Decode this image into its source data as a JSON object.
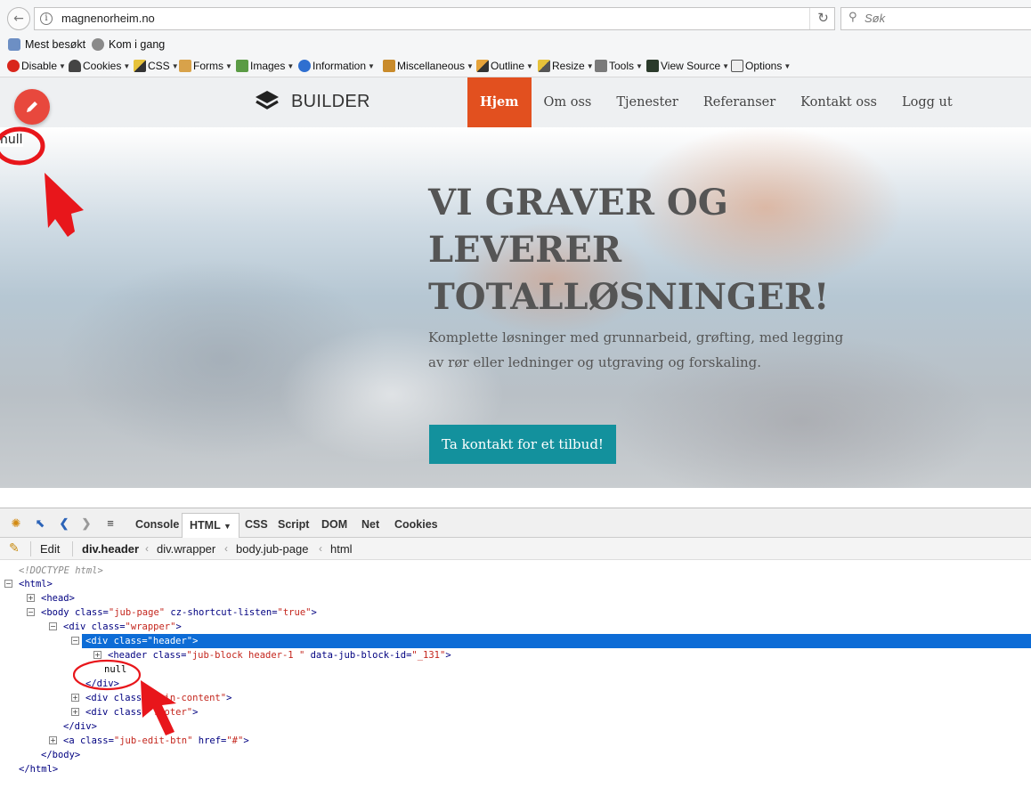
{
  "browser": {
    "url": "magnenorheim.no",
    "search_placeholder": "Søk",
    "bookmarks": [
      "Mest besøkt",
      "Kom i gang"
    ],
    "dev_toolbar": [
      "Disable",
      "Cookies",
      "CSS",
      "Forms",
      "Images",
      "Information",
      "Miscellaneous",
      "Outline",
      "Resize",
      "Tools",
      "View Source",
      "Options"
    ]
  },
  "site": {
    "brand": "BUILDER",
    "nav": [
      "Hjem",
      "Om oss",
      "Tjenester",
      "Referanser",
      "Kontakt oss",
      "Logg ut"
    ],
    "active_nav": "Hjem",
    "null_text": "null",
    "hero": {
      "title": "VI GRAVER OG LEVERER TOTALLØSNINGER!",
      "subtitle": "Komplette løsninger med grunnarbeid, grøfting, med legging av rør eller ledninger og utgraving og forskaling.",
      "cta": "Ta kontakt for et tilbud!"
    }
  },
  "firebug": {
    "tabs": [
      "Console",
      "HTML",
      "CSS",
      "Script",
      "DOM",
      "Net",
      "Cookies"
    ],
    "active_tab": "HTML",
    "edit_label": "Edit",
    "breadcrumbs": [
      "div.header",
      "div.wrapper",
      "body.jub-page",
      "html"
    ],
    "tree": {
      "doctype": "<!DOCTYPE html>",
      "html_open": "<html>",
      "head": "<head>",
      "body_open": [
        "<body ",
        "class=",
        "\"jub-page\"",
        " cz-shortcut-listen=",
        "\"true\"",
        ">"
      ],
      "wrapper_open": [
        "<div ",
        "class=",
        "\"wrapper\"",
        ">"
      ],
      "header_open": [
        "<div ",
        "class=",
        "\"header\"",
        ">"
      ],
      "header_el": [
        "<header ",
        "class=",
        "\"jub-block header-1 \"",
        " data-jub-block-id=",
        "\"_131\"",
        ">"
      ],
      "null_node": "null",
      "div_close": "</div>",
      "main_content": [
        "<div ",
        "class=",
        "\"main-content\"",
        ">"
      ],
      "footer": [
        "<div ",
        "class=",
        "\"footer\"",
        ">"
      ],
      "wrapper_close": "</div>",
      "edit_btn": [
        "<a ",
        "class=",
        "\"jub-edit-btn\"",
        " href=",
        "\"#\"",
        ">"
      ],
      "body_close": "</body>",
      "html_close": "</html>"
    }
  },
  "colors": {
    "accent_nav": "#e2501f",
    "cta": "#13919d",
    "edit_fab": "#e8483d",
    "selection": "#0d6cd6",
    "annotation": "#e8161b"
  }
}
